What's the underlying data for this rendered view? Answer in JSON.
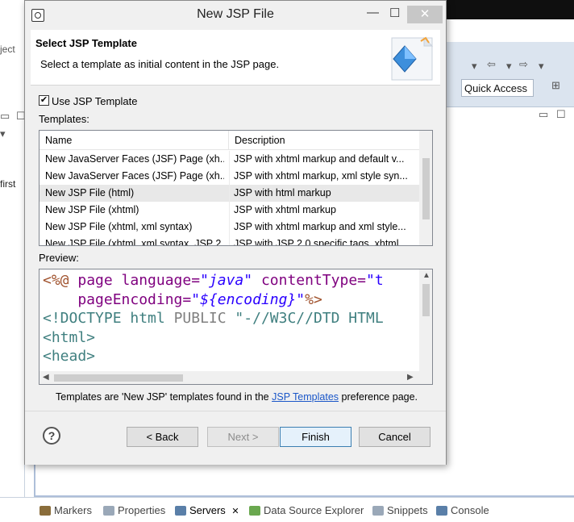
{
  "background": {
    "left_partial_texts": [
      "ject",
      "first"
    ],
    "quick_access": "Quick Access",
    "bottom_tabs": [
      {
        "label": "Markers",
        "icon": "markers-icon",
        "color": "#8a6d3b",
        "active": false
      },
      {
        "label": "Properties",
        "icon": "properties-icon",
        "color": "#9aa8b8",
        "active": false
      },
      {
        "label": "Servers",
        "icon": "servers-icon",
        "color": "#5a7fa8",
        "active": true,
        "close": "✕"
      },
      {
        "label": "Data Source Explorer",
        "icon": "data-source-icon",
        "color": "#6aa84f",
        "active": false
      },
      {
        "label": "Snippets",
        "icon": "snippets-icon",
        "color": "#9aa8b8",
        "active": false
      },
      {
        "label": "Console",
        "icon": "console-icon",
        "color": "#5a7fa8",
        "active": false
      }
    ]
  },
  "dialog": {
    "title": "New JSP File",
    "header": {
      "title": "Select JSP Template",
      "description": "Select a template as initial content in the JSP page."
    },
    "use_template": {
      "label": "Use JSP Template",
      "checked": true,
      "check_glyph": "✔"
    },
    "templates_label": "Templates:",
    "table": {
      "columns": [
        "Name",
        "Description"
      ],
      "rows": [
        {
          "name": "New JavaServer Faces (JSF) Page (xh...",
          "description": "JSP with xhtml markup and default v...",
          "selected": false
        },
        {
          "name": "New JavaServer Faces (JSF) Page (xh...",
          "description": "JSP with xhtml markup, xml style syn...",
          "selected": false
        },
        {
          "name": "New JSP File (html)",
          "description": "JSP with html markup",
          "selected": true
        },
        {
          "name": "New JSP File (xhtml)",
          "description": "JSP with xhtml markup",
          "selected": false
        },
        {
          "name": "New JSP File (xhtml, xml syntax)",
          "description": "JSP with xhtml markup and xml style...",
          "selected": false
        },
        {
          "name": "New JSP File (xhtml, xml syntax, JSP 2...",
          "description": "JSP with JSP 2.0 specific tags, xhtml...",
          "selected": false
        }
      ]
    },
    "preview_label": "Preview:",
    "preview_code": {
      "line1_dir": "<%@",
      "line1_attr1": " page language=",
      "line1_val1": "\"java\"",
      "line1_attr2": " contentType=",
      "line1_val2": "\"t",
      "line2_attr": "    pageEncoding=",
      "line2_val": "\"${encoding}\"",
      "line2_dir": "%>",
      "line3_tag": "<!DOCTYPE html ",
      "line3_pub": "PUBLIC",
      "line3_rest": " \"-//W3C//DTD HTML",
      "line4_tag": "<html>",
      "line5_tag": "<head>"
    },
    "footer": {
      "prefix": "Templates are 'New JSP' templates found in the ",
      "link": "JSP Templates",
      "suffix": " preference page."
    },
    "buttons": {
      "help": "?",
      "back": "< Back",
      "next": "Next >",
      "finish": "Finish",
      "cancel": "Cancel"
    },
    "window_controls": {
      "minimize": "—",
      "maximize": "☐",
      "close": "✕"
    }
  }
}
